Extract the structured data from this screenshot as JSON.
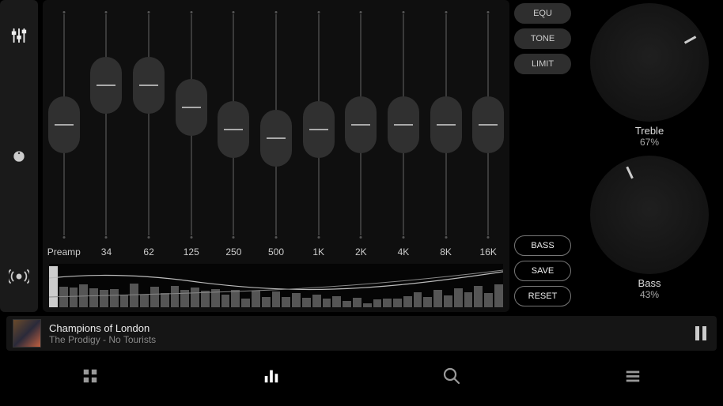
{
  "toolstrip": {
    "items": [
      "eq-sliders-icon",
      "knob-icon",
      "surround-icon"
    ]
  },
  "eq": {
    "preamp_label": "Preamp",
    "band_labels": [
      "34",
      "62",
      "125",
      "250",
      "500",
      "1K",
      "2K",
      "4K",
      "8K",
      "16K"
    ],
    "slider_positions_pct": [
      50,
      32,
      32,
      42,
      52,
      56,
      52,
      50,
      50,
      50,
      50
    ]
  },
  "buttons_top": {
    "equ": "EQU",
    "tone": "TONE",
    "limit": "LIMIT"
  },
  "buttons_bot": {
    "bass": "BASS",
    "save": "SAVE",
    "reset": "RESET"
  },
  "knobs": {
    "treble": {
      "label": "Treble",
      "value_text": "67%",
      "angle_deg": 61
    },
    "bass": {
      "label": "Bass",
      "value_text": "43%",
      "angle_deg": -25
    }
  },
  "spectrum_bars_pct": [
    95,
    48,
    45,
    52,
    44,
    40,
    42,
    30,
    55,
    30,
    48,
    32,
    50,
    40,
    46,
    38,
    42,
    30,
    40,
    20,
    38,
    24,
    36,
    24,
    32,
    22,
    30,
    20,
    25,
    14,
    22,
    10,
    18,
    20,
    20,
    25,
    34,
    24,
    40,
    28,
    44,
    34,
    50,
    32,
    52
  ],
  "nowplaying": {
    "title": "Champions of London",
    "subtitle": "The Prodigy - No Tourists",
    "state": "playing"
  },
  "bottomnav": {
    "items": [
      "grid-icon",
      "equalizer-icon",
      "search-icon",
      "menu-icon"
    ],
    "active_index": 1
  }
}
